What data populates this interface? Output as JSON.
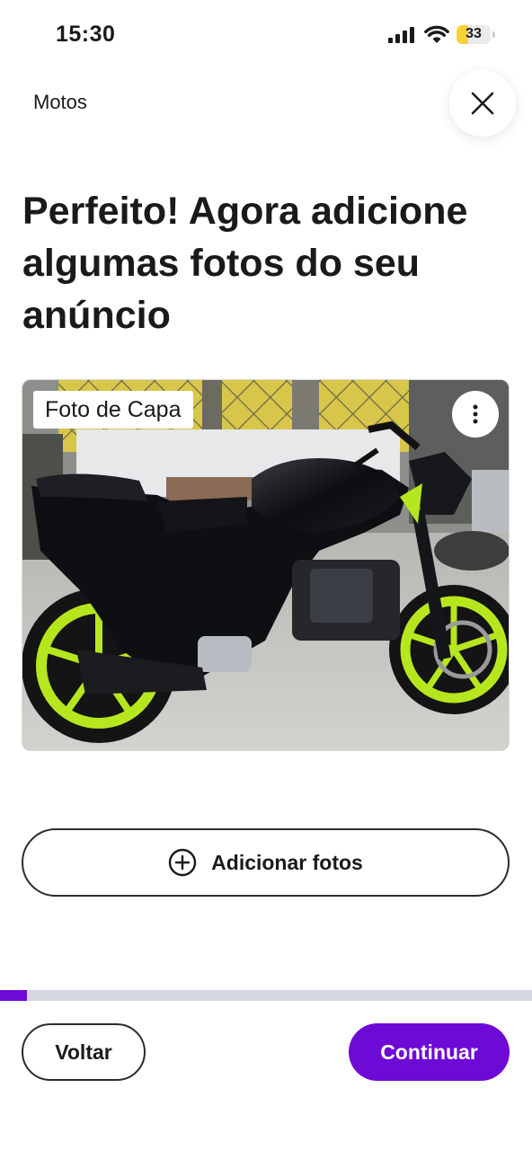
{
  "status_bar": {
    "time": "15:30",
    "battery_level": "33",
    "battery_fraction": 0.33,
    "battery_color": "#f5d23a"
  },
  "header": {
    "category": "Motos",
    "close_icon": "close-icon"
  },
  "headline": "Perfeito! Agora adicione algumas fotos do seu anúncio",
  "photos": [
    {
      "label": "Foto de Capa",
      "menu_icon": "more-vertical-icon"
    }
  ],
  "add_photos": {
    "label": "Adicionar fotos",
    "icon": "plus-circle-icon"
  },
  "progress": {
    "fraction": 0.05,
    "fill_color": "#6e0ad6",
    "track_color": "#d3d7df"
  },
  "footer": {
    "back_label": "Voltar",
    "continue_label": "Continuar",
    "accent_color": "#6e0ad6"
  }
}
